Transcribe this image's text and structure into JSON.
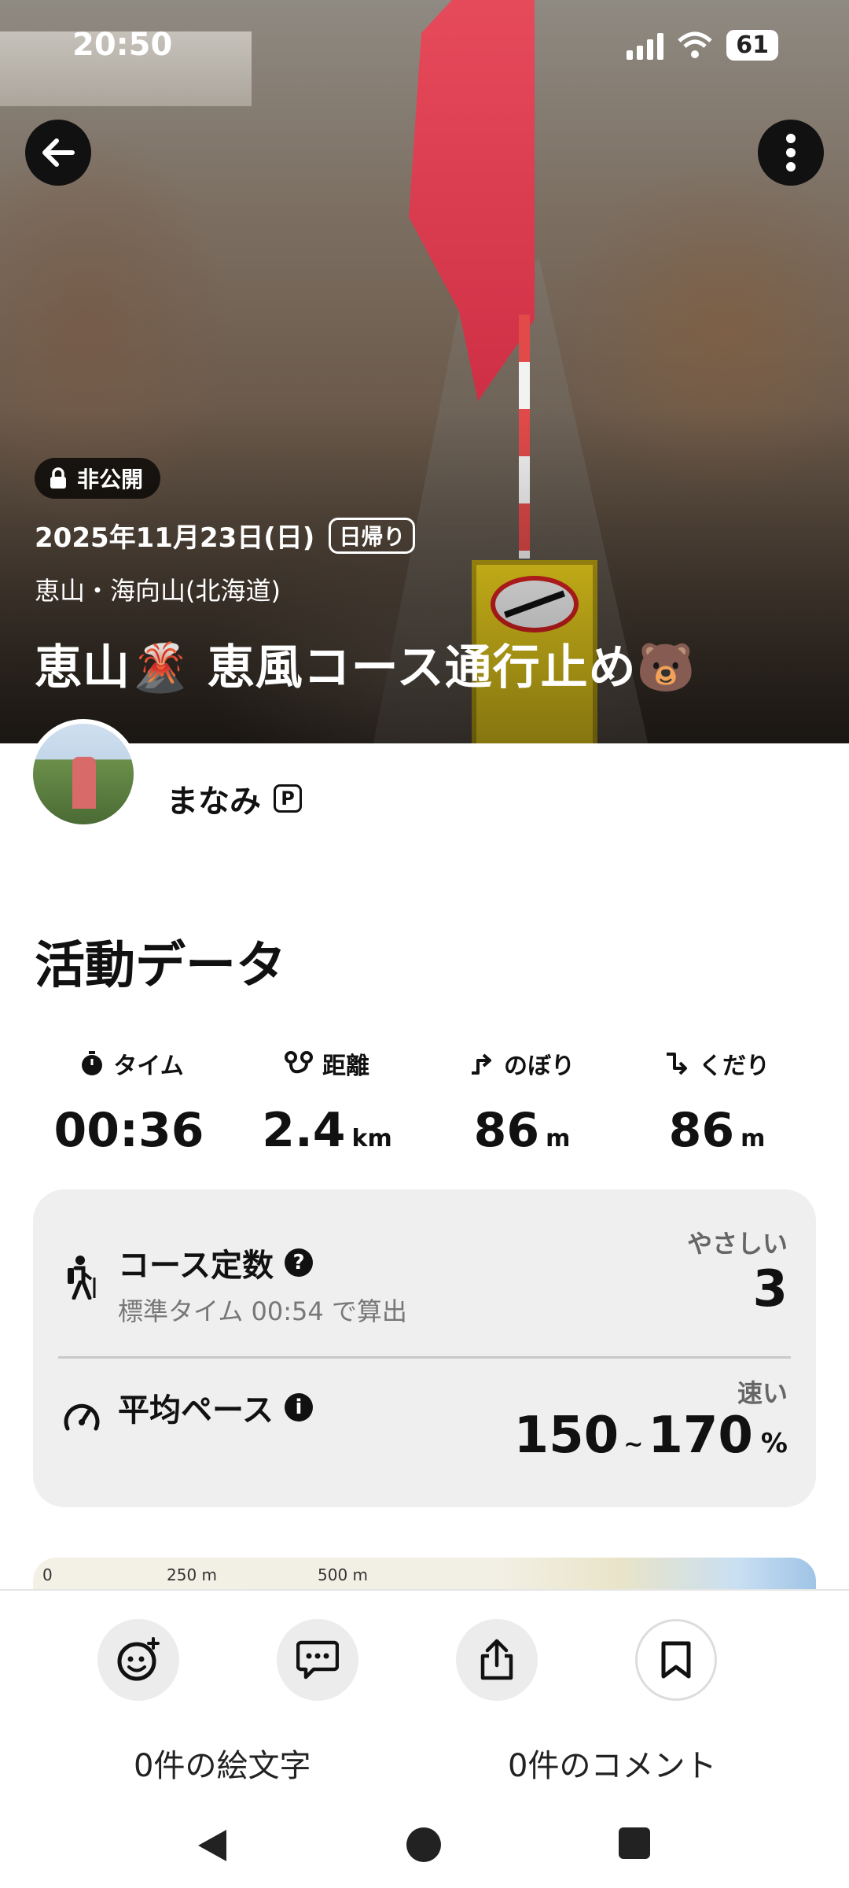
{
  "status_bar": {
    "time": "20:50",
    "battery": "61"
  },
  "hero": {
    "privacy_badge": "非公開",
    "date": "2025年11月23日(日)",
    "trip_type": "日帰り",
    "area": "恵山・海向山(北海道)",
    "title": "恵山🌋 恵風コース通行止め🐻"
  },
  "user": {
    "name": "まなみ",
    "badge": "P"
  },
  "activity": {
    "title": "活動データ",
    "stats": [
      {
        "label": "タイム",
        "value": "00:36",
        "unit": ""
      },
      {
        "label": "距離",
        "value": "2.4",
        "unit": "km"
      },
      {
        "label": "のぼり",
        "value": "86",
        "unit": "m"
      },
      {
        "label": "くだり",
        "value": "86",
        "unit": "m"
      }
    ]
  },
  "course_card": {
    "course_constant": {
      "title": "コース定数",
      "subtitle": "標準タイム 00:54 で算出",
      "level": "やさしい",
      "value": "3"
    },
    "avg_pace": {
      "title": "平均ペース",
      "level": "速い",
      "min": "150",
      "sep": "~",
      "max": "170",
      "unit": "%"
    }
  },
  "map": {
    "scale": [
      "0",
      "250 m",
      "500 m"
    ]
  },
  "bottom_bar": {
    "emoji_label": "0件の絵文字",
    "comment_label": "0件のコメント"
  },
  "colors": {
    "accent": "#111111",
    "card_bg": "#efefef",
    "flag": "#d93447"
  }
}
